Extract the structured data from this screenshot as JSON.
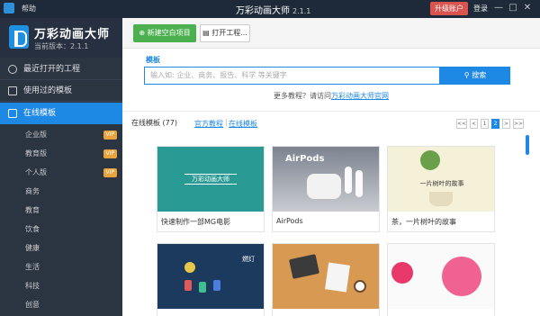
{
  "titlebar": {
    "help": "帮助",
    "title": "万彩动画大师",
    "version": "2.1.1",
    "upgrade": "升级账户",
    "login": "登录",
    "minimize": "—",
    "maximize": "□",
    "close": "✕"
  },
  "logo": {
    "name": "万彩动画大师",
    "version": "当前版本：2.1.1"
  },
  "sidebar": {
    "items": [
      {
        "label": "最近打开的工程"
      },
      {
        "label": "使用过的模板"
      },
      {
        "label": "在线模板"
      }
    ],
    "subitems": [
      {
        "label": "企业版",
        "vip": "VIP"
      },
      {
        "label": "教育版",
        "vip": "VIP"
      },
      {
        "label": "个人版",
        "vip": "VIP"
      },
      {
        "label": "商务"
      },
      {
        "label": "教育"
      },
      {
        "label": "饮食"
      },
      {
        "label": "健康"
      },
      {
        "label": "生活"
      },
      {
        "label": "科技"
      },
      {
        "label": "创意"
      }
    ]
  },
  "toolbar": {
    "new_project": "新建空白项目",
    "open_project": "打开工程..."
  },
  "search": {
    "label": "模板",
    "placeholder": "输入如: 企业、商务、报告、科学 等关键字",
    "button": "搜索",
    "tutorial_prefix": "更多教程？请访问",
    "tutorial_link": "万彩动画大师官网"
  },
  "list": {
    "count_label": "在线模板 (77)",
    "link_official": "官方教程",
    "link_online": "在线模板",
    "pager": [
      "<<",
      "<",
      "1",
      "2",
      ">",
      ">>"
    ],
    "current_page": "2"
  },
  "templates": [
    {
      "caption": "快速制作一部MG电影",
      "thumb_text": "万彩动画大师"
    },
    {
      "caption": "AirPods",
      "thumb_text": "AirPods"
    },
    {
      "caption": "茶，一片树叶的故事",
      "thumb_text": "一片树叶的故事"
    },
    {
      "caption": "",
      "thumb_text": "燃灯"
    },
    {
      "caption": "",
      "thumb_text": ""
    },
    {
      "caption": "",
      "thumb_text": ""
    }
  ],
  "colors": {
    "accent": "#1e88e5",
    "sidebar_bg": "#2b3441",
    "titlebar_bg": "#1e2a3a",
    "upgrade": "#d9534f",
    "new_button": "#4caf50",
    "vip": "#e8a33d"
  }
}
